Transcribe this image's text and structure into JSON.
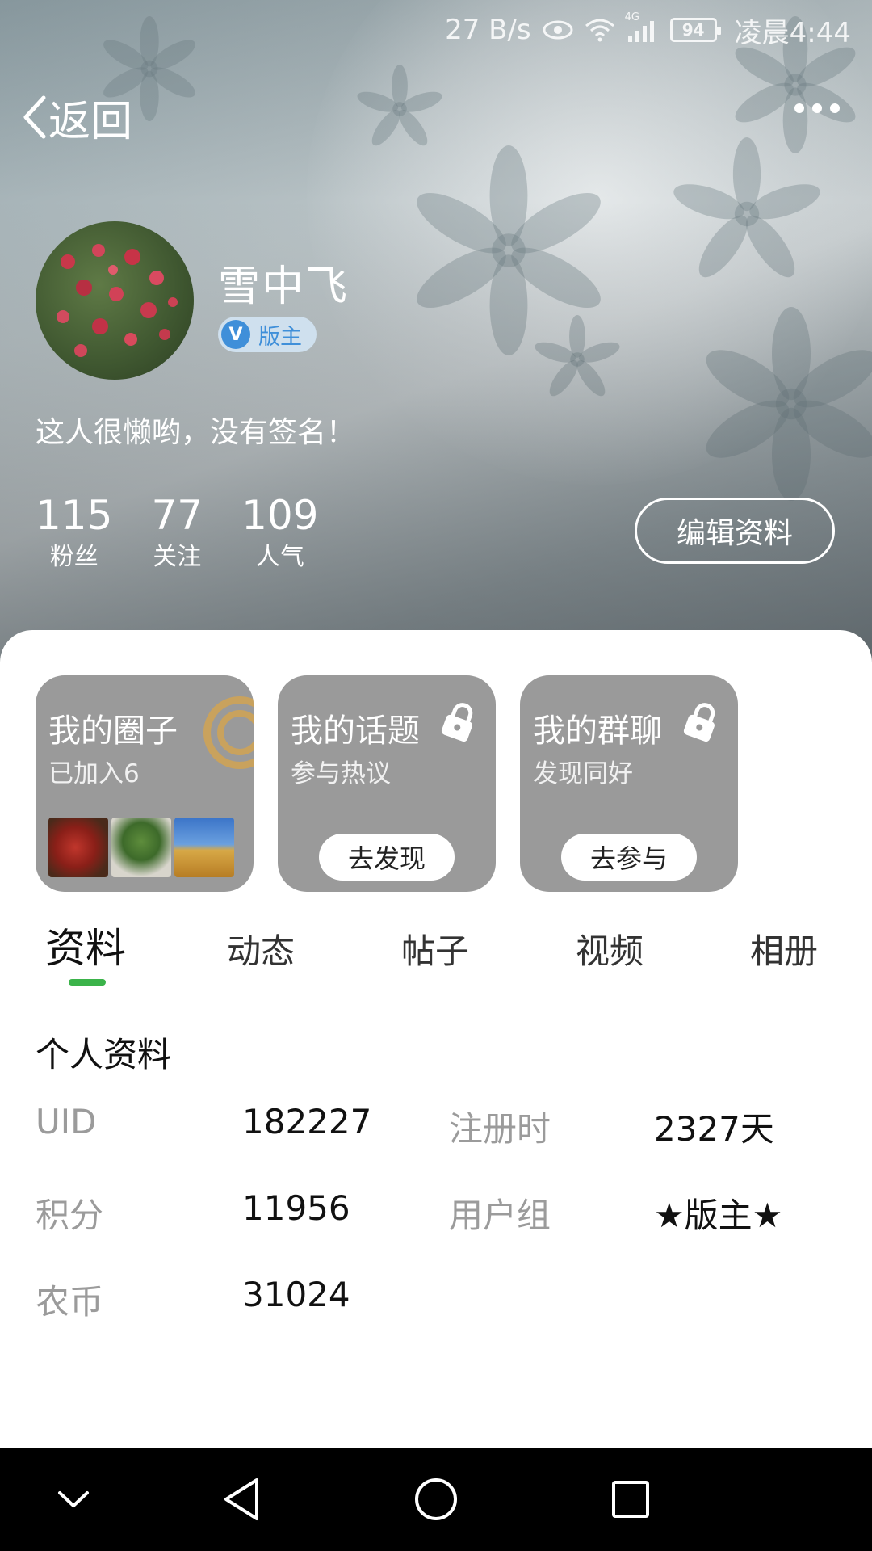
{
  "status_bar": {
    "net_speed": "27 B/s",
    "network": "4G",
    "battery": "94",
    "time": "凌晨4:44"
  },
  "nav": {
    "back_label": "返回"
  },
  "profile": {
    "name": "雪中飞",
    "role_badge_letter": "V",
    "role": "版主",
    "signature": "这人很懒哟，没有签名！",
    "stats": [
      {
        "value": "115",
        "label": "粉丝"
      },
      {
        "value": "77",
        "label": "关注"
      },
      {
        "value": "109",
        "label": "人气"
      }
    ],
    "edit_label": "编辑资料"
  },
  "cards": [
    {
      "title": "我的圈子",
      "subtitle": "已加入6"
    },
    {
      "title": "我的话题",
      "subtitle": "参与热议",
      "button": "去发现"
    },
    {
      "title": "我的群聊",
      "subtitle": "发现同好",
      "button": "去参与"
    }
  ],
  "tabs": [
    "资料",
    "动态",
    "帖子",
    "视频",
    "相册"
  ],
  "active_tab": "资料",
  "info": {
    "section_title": "个人资料",
    "rows": [
      {
        "k1": "UID",
        "v1": "182227",
        "k2": "注册时",
        "v2": "2327天"
      },
      {
        "k1": "积分",
        "v1": "11956",
        "k2": "用户组",
        "v2": "★版主★"
      },
      {
        "k1": "农币",
        "v1": "31024",
        "k2": "",
        "v2": ""
      }
    ]
  },
  "colors": {
    "accent_green": "#3bb34a",
    "badge_blue": "#3f8fd9",
    "card_gray": "#9a9a9a"
  }
}
